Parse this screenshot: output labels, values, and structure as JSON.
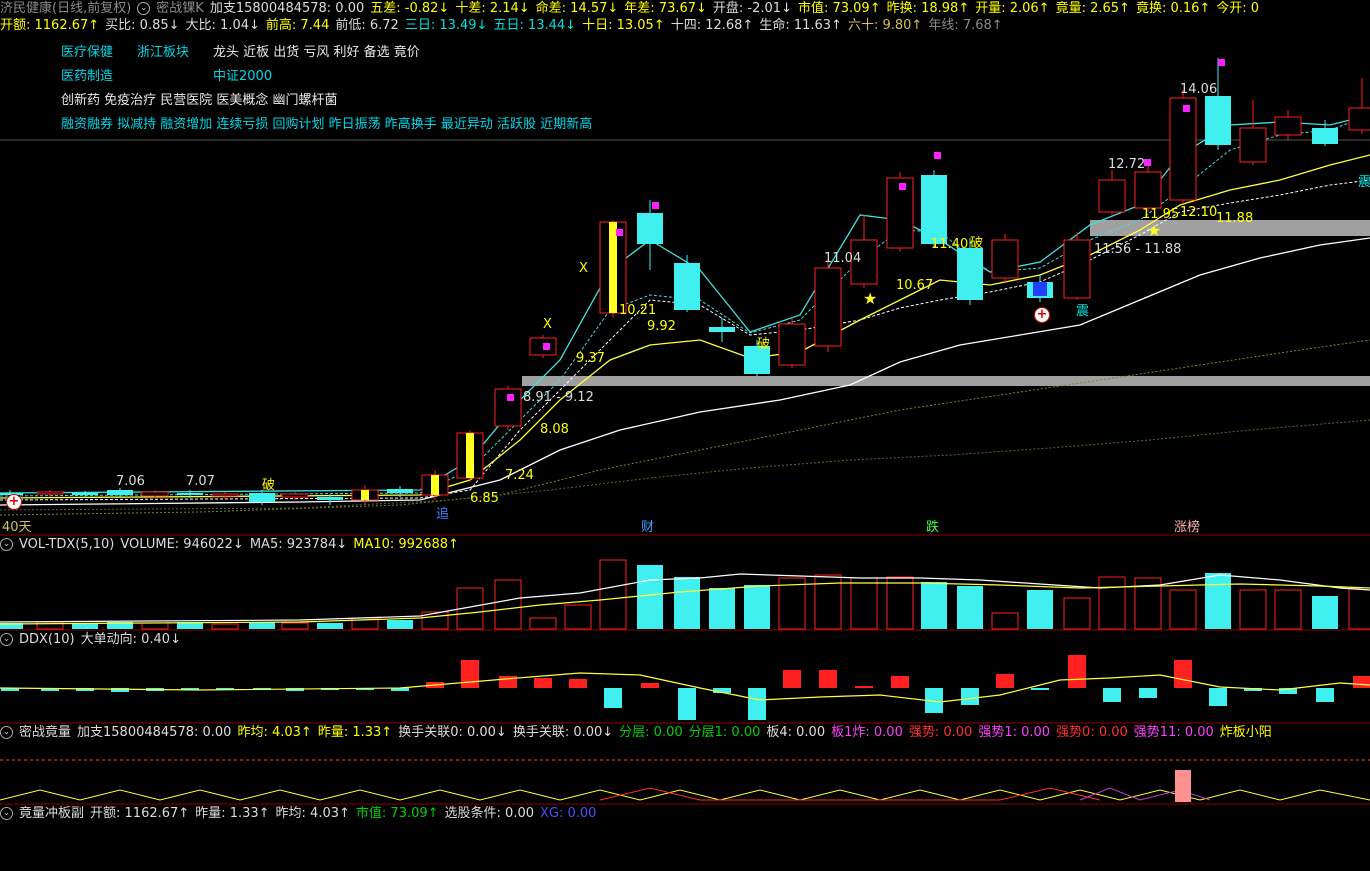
{
  "header1": [
    {
      "t": "济民健康(日线,前复权)",
      "c": "gy"
    },
    {
      "t": "密战锞K",
      "c": "gy",
      "icon": true
    },
    {
      "t": "加支15800484578: 0.00",
      "c": "w"
    },
    {
      "t": "五差: -0.82↓",
      "c": "y"
    },
    {
      "t": "十差: 2.14↓",
      "c": "y"
    },
    {
      "t": "命差: 14.57↓",
      "c": "y"
    },
    {
      "t": "年差: 73.67↓",
      "c": "y"
    },
    {
      "t": "开盘: -2.01↓",
      "c": "w"
    },
    {
      "t": "市值: 73.09↑",
      "c": "y"
    },
    {
      "t": "昨换: 18.98↑",
      "c": "y"
    },
    {
      "t": "开量: 2.06↑",
      "c": "y"
    },
    {
      "t": "竟量: 2.65↑",
      "c": "y"
    },
    {
      "t": "竟换: 0.16↑",
      "c": "y"
    },
    {
      "t": "今开: 0",
      "c": "y"
    }
  ],
  "header2": [
    {
      "t": "开额: 1162.67↑",
      "c": "y"
    },
    {
      "t": "买比: 0.85↓",
      "c": "w"
    },
    {
      "t": "大比: 1.04↓",
      "c": "w"
    },
    {
      "t": "前高: 7.44",
      "c": "y"
    },
    {
      "t": "前低: 6.72",
      "c": "w"
    },
    {
      "t": "三日: 13.49↓",
      "c": "c"
    },
    {
      "t": "五日: 13.44↓",
      "c": "c"
    },
    {
      "t": "十日: 13.05↑",
      "c": "y"
    },
    {
      "t": "十四: 12.68↑",
      "c": "w"
    },
    {
      "t": "生命: 11.63↑",
      "c": "w"
    },
    {
      "t": "六十: 9.80↑",
      "c": "o"
    },
    {
      "t": "年线: 7.68↑",
      "c": "gy"
    }
  ],
  "tags": {
    "l1a": "医疗保健",
    "l1b": "浙江板块",
    "l1c": "龙头 近板 出货 亏风 利好 备选 竟价",
    "l2a": "医药制造",
    "l2b": "中证2000",
    "l3": "创新药 免疫治疗 民营医院 医美概念 幽门螺杆菌",
    "l4": "融资融券 拟减持 融资增加 连续亏损 回购计划 昨日振荡 昨高换手 最近异动 活跃股 近期新高"
  },
  "price_labels": {
    "p706": "7.06",
    "p707": "7.07",
    "p685": "6.85",
    "p724": "7.24",
    "p808": "8.08",
    "p937": "9.37",
    "p891": "8.91 - 9.12",
    "p1021": "10.21",
    "p992": "9.92",
    "p1104": "11.04",
    "p1067": "10.67",
    "p1140": "11.40",
    "p1272": "12.72",
    "p1195": "11.95",
    "p1210": "12.10",
    "p1188": "11.88",
    "p1156": "11.56 - 11.88",
    "p1406": "14.06",
    "x1": "X",
    "x2": "X",
    "po1": "破",
    "po2": "破",
    "po3": "破",
    "zhen1": "震",
    "zhen2": "震"
  },
  "bottom_markers": {
    "days": "40天",
    "cai": "财",
    "die": "跌",
    "zhangbang": "涨榜",
    "zhui": "追"
  },
  "vol_header": [
    {
      "t": "VOL-TDX(5,10)",
      "c": "w"
    },
    {
      "t": "VOLUME: 946022↓",
      "c": "w"
    },
    {
      "t": "MA5: 923784↓",
      "c": "w"
    },
    {
      "t": "MA10: 992688↑",
      "c": "y"
    }
  ],
  "ddx_header": [
    {
      "t": "DDX(10)",
      "c": "w"
    },
    {
      "t": "大单动向: 0.40↓",
      "c": "w"
    }
  ],
  "mzjl_header": [
    {
      "t": "密战竟量",
      "c": "w"
    },
    {
      "t": "加支15800484578: 0.00",
      "c": "w"
    },
    {
      "t": "昨均: 4.03↑",
      "c": "y"
    },
    {
      "t": "昨量: 1.33↑",
      "c": "y"
    },
    {
      "t": "换手关联0: 0.00↓",
      "c": "w"
    },
    {
      "t": "换手关联: 0.00↓",
      "c": "w"
    },
    {
      "t": "分层: 0.00",
      "c": "g"
    },
    {
      "t": "分层1: 0.00",
      "c": "g"
    },
    {
      "t": "板4: 0.00",
      "c": "w"
    },
    {
      "t": "板1炸: 0.00",
      "c": "m"
    },
    {
      "t": "强势: 0.00",
      "c": "r"
    },
    {
      "t": "强势1: 0.00",
      "c": "m"
    },
    {
      "t": "强势0: 0.00",
      "c": "r"
    },
    {
      "t": "强势11: 0.00",
      "c": "m"
    },
    {
      "t": "炸板小阳",
      "c": "y"
    }
  ],
  "jlcb_header": [
    {
      "t": "竟量冲板副",
      "c": "w"
    },
    {
      "t": "开额: 1162.67↑",
      "c": "w"
    },
    {
      "t": "昨量: 1.33↑",
      "c": "w"
    },
    {
      "t": "昨均: 4.03↑",
      "c": "w"
    },
    {
      "t": "市值: 73.09↑",
      "c": "g"
    },
    {
      "t": "选股条件: 0.00",
      "c": "w"
    },
    {
      "t": "XG: 0.00",
      "c": "b"
    }
  ],
  "colors": {
    "up": "#ff2020",
    "down": "#40f0f0",
    "bg": "#000000",
    "sep": "#8b0000",
    "ma5": "#40e0e0",
    "ma10": "#ffff40",
    "ma20": "#ffffff"
  }
}
